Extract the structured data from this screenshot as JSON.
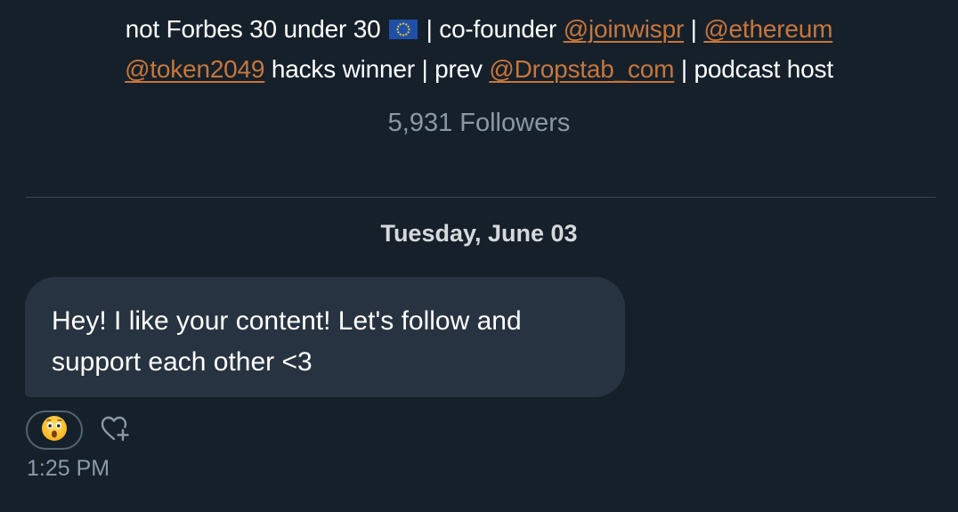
{
  "profile": {
    "bio_prefix_1": "not Forbes 30 under 30 ",
    "flag_icon": "eu-flag-emoji",
    "bio_sep_1": " | co-founder ",
    "mention_1": "@joinwispr",
    "bio_sep_2": " | ",
    "mention_2": "@ethereum",
    "mention_3": "@token2049",
    "bio_mid_2": " hacks winner | prev ",
    "mention_4": "@Dropstab_com",
    "bio_suffix_2": " | podcast host",
    "followers_text": "5,931 Followers"
  },
  "conversation": {
    "date_separator": "Tuesday, June 03",
    "messages": [
      {
        "text": "Hey! I like your content! Let's follow and support each other <3",
        "reaction_icon": "astonished-face-emoji",
        "add_reaction_icon": "heart-plus-icon",
        "time": "1:25 PM"
      }
    ]
  },
  "colors": {
    "background": "#15202b",
    "bubble": "#273340",
    "mention": "#c8763a",
    "muted_text": "#8b98a5",
    "divider": "#38444d"
  }
}
